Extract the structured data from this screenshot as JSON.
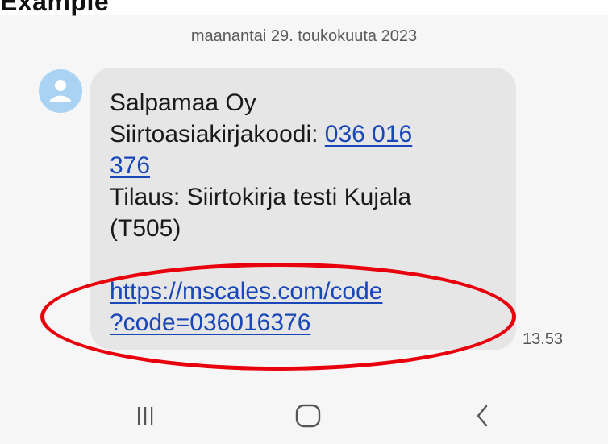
{
  "header": {
    "partial_title": "Example"
  },
  "conversation": {
    "date": "maanantai 29. toukokuuta 2023",
    "message": {
      "sender": "Salpamaa Oy",
      "code_label": "Siirtoasiakirjakoodi: ",
      "code_part1": "036 016",
      "code_part2": "376",
      "order_line1": "Tilaus: Siirtokirja testi Kujala",
      "order_line2": "(T505)",
      "link_part1": "https://mscales.com/code",
      "link_part2": "?code=036016376",
      "time": "13.53"
    }
  },
  "colors": {
    "bubble": "#e6e6e6",
    "link": "#1a47b8",
    "avatar": "#a9d2f3",
    "highlight": "#e8000d"
  },
  "icons": {
    "recent_apps": "recent-apps-icon",
    "home": "home-icon",
    "back": "back-icon",
    "avatar": "person-icon"
  }
}
